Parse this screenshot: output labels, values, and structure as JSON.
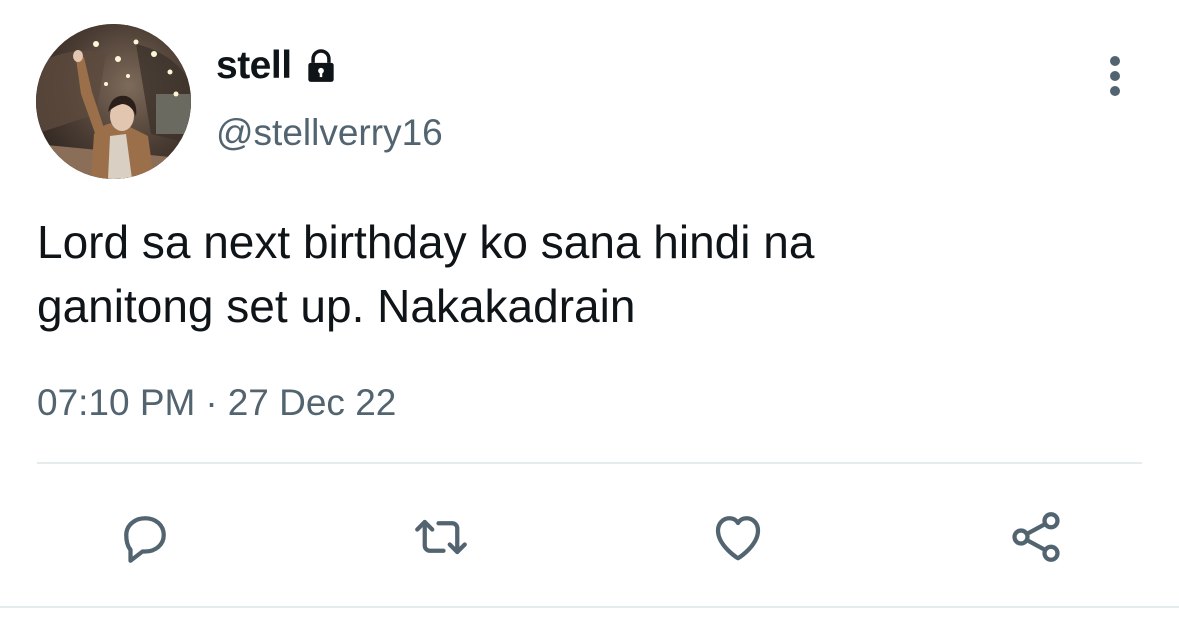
{
  "author": {
    "display_name": "stell",
    "handle": "@stellverry16",
    "protected": true,
    "avatar": "avatar-photo"
  },
  "tweet": {
    "text": "Lord sa next birthday ko sana hindi na\nganitong set up. Nakakadrain",
    "time": "07:10 PM",
    "separator": "·",
    "date": "27 Dec 22"
  },
  "icons": {
    "lock": "lock-icon",
    "more": "more-vertical-icon",
    "reply": "reply-icon",
    "retweet": "retweet-icon",
    "like": "heart-icon",
    "share": "share-icon"
  },
  "colors": {
    "text": "#0f1419",
    "secondary": "#536471",
    "divider": "#e6ebee"
  }
}
